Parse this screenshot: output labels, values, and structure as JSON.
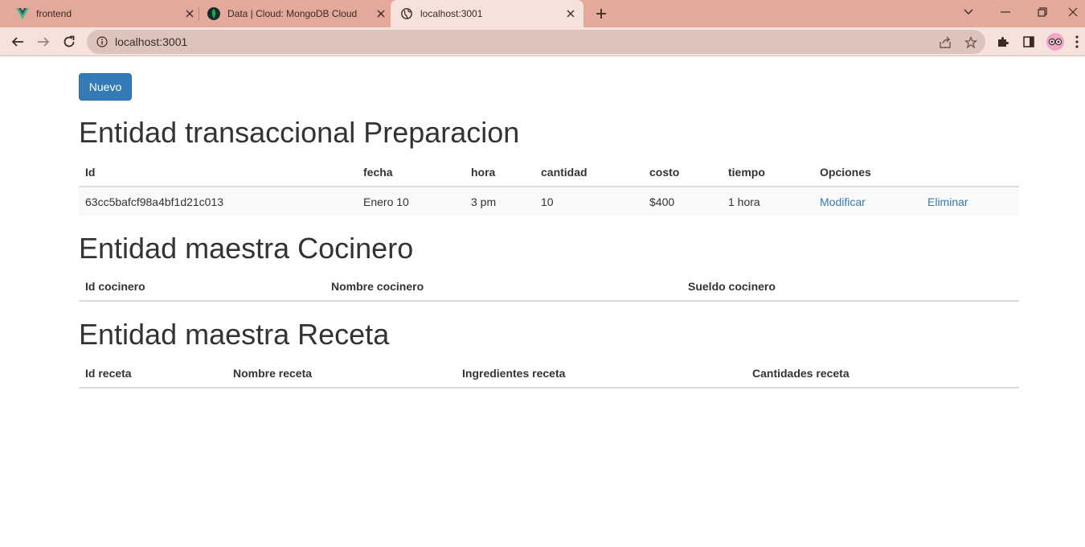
{
  "browser": {
    "tabs": [
      {
        "title": "frontend",
        "icon": "vue-icon"
      },
      {
        "title": "Data | Cloud: MongoDB Cloud",
        "icon": "mongodb-leaf-icon"
      },
      {
        "title": "localhost:3001",
        "icon": "globe-icon",
        "active": true
      }
    ],
    "url": "localhost:3001"
  },
  "page": {
    "new_button": "Nuevo",
    "preparacion": {
      "title": "Entidad transaccional Preparacion",
      "headers": [
        "Id",
        "fecha",
        "hora",
        "cantidad",
        "costo",
        "tiempo",
        "Opciones"
      ],
      "rows": [
        {
          "id": "63cc5bafcf98a4bf1d21c013",
          "fecha": "Enero 10",
          "hora": "3 pm",
          "cantidad": "10",
          "costo": "$400",
          "tiempo": "1 hora",
          "modificar": "Modificar",
          "eliminar": "Eliminar"
        }
      ]
    },
    "cocinero": {
      "title": "Entidad maestra Cocinero",
      "headers": [
        "Id cocinero",
        "Nombre cocinero",
        "Sueldo cocinero"
      ]
    },
    "receta": {
      "title": "Entidad maestra Receta",
      "headers": [
        "Id receta",
        "Nombre receta",
        "Ingredientes receta",
        "Cantidades receta"
      ]
    }
  },
  "colors": {
    "tabstrip": "#e3a99a",
    "toolbar": "#f6e1dc",
    "primary": "#337ab7",
    "link": "#337ab7"
  }
}
